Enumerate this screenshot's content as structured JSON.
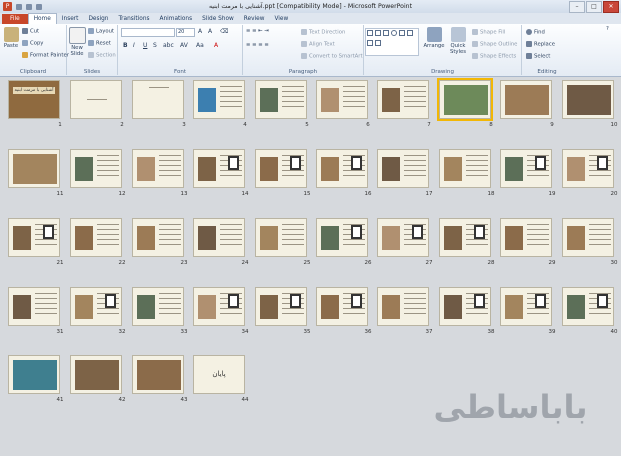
{
  "window": {
    "title": "آشنایی با مرمت ابنیه.ppt [Compatibility Mode] - Microsoft PowerPoint",
    "app_icon": "P",
    "minimize": "–",
    "maximize": "□",
    "close": "✕"
  },
  "tabs": [
    "File",
    "Home",
    "Insert",
    "Design",
    "Transitions",
    "Animations",
    "Slide Show",
    "Review",
    "View"
  ],
  "active_tab": "Home",
  "ribbon": {
    "clipboard": {
      "label": "Clipboard",
      "paste": "Paste",
      "cut": "Cut",
      "copy": "Copy",
      "format_painter": "Format Painter"
    },
    "slides": {
      "label": "Slides",
      "new_slide": "New Slide",
      "layout": "Layout",
      "reset": "Reset",
      "section": "Section"
    },
    "font": {
      "label": "Font",
      "font_size": "20"
    },
    "paragraph": {
      "label": "Paragraph",
      "text_direction": "Text Direction",
      "align_text": "Align Text",
      "convert_smartart": "Convert to SmartArt"
    },
    "drawing": {
      "label": "Drawing",
      "arrange": "Arrange",
      "quick_styles": "Quick Styles",
      "shape_fill": "Shape Fill",
      "shape_outline": "Shape Outline",
      "shape_effects": "Shape Effects"
    },
    "editing": {
      "label": "Editing",
      "find": "Find",
      "replace": "Replace",
      "select": "Select"
    }
  },
  "slides": {
    "numbers": [
      "1",
      "2",
      "3",
      "4",
      "5",
      "6",
      "7",
      "8",
      "9",
      "10",
      "11",
      "12",
      "13",
      "14",
      "15",
      "16",
      "17",
      "18",
      "19",
      "20",
      "21",
      "22",
      "23",
      "24",
      "25",
      "26",
      "27",
      "28",
      "29",
      "30",
      "31",
      "32",
      "33",
      "34",
      "35",
      "36",
      "37",
      "38",
      "39",
      "40",
      "41",
      "42",
      "43",
      "44"
    ],
    "selected": "8",
    "slide1_title": "آشنایی با مرمت ابنیه",
    "slide44_text": "پایان"
  },
  "watermark": "باباساطی",
  "colors": {
    "file_tab": "#c8472a",
    "selected_outline": "#f2b705",
    "slide_bg": "#f4f1e3",
    "sorter_bg": "#d6d9dd"
  }
}
